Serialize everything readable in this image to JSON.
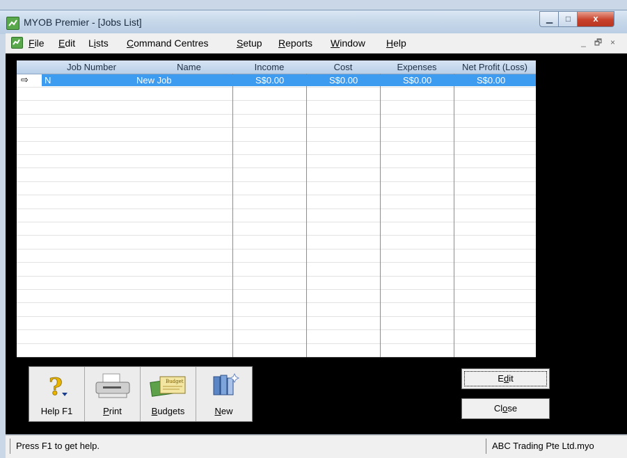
{
  "window": {
    "title": "MYOB Premier - [Jobs List]",
    "controls": {
      "minimize": "▁",
      "maximize": "□",
      "close": "x"
    }
  },
  "menubar": {
    "items": [
      {
        "label": "File",
        "underline": "F"
      },
      {
        "label": "Edit",
        "underline": "E"
      },
      {
        "label": "Lists",
        "underline": "i"
      },
      {
        "label": "Command Centres",
        "underline": "C"
      },
      {
        "label": "Setup",
        "underline": "S"
      },
      {
        "label": "Reports",
        "underline": "R"
      },
      {
        "label": "Window",
        "underline": "W"
      },
      {
        "label": "Help",
        "underline": "H"
      }
    ],
    "mdi_controls": {
      "minimize": "_",
      "restore": "🗗",
      "close": "×"
    }
  },
  "grid": {
    "columns": [
      "Job Number",
      "Name",
      "Income",
      "Cost",
      "Expenses",
      "Net Profit (Loss)"
    ],
    "selected_row": {
      "job_number": "N",
      "name": "New Job",
      "income": "S$0.00",
      "cost": "S$0.00",
      "expenses": "S$0.00",
      "net_profit": "S$0.00"
    },
    "row_marker": "⇨"
  },
  "toolbar": {
    "buttons": [
      {
        "label": "Help F1",
        "icon": "help-icon"
      },
      {
        "label": "Print",
        "underline": "P",
        "icon": "printer-icon"
      },
      {
        "label": "Budgets",
        "underline": "B",
        "icon": "budget-icon"
      },
      {
        "label": "New",
        "underline": "N",
        "icon": "new-document-icon"
      }
    ]
  },
  "actions": {
    "edit": "Edit",
    "close": "Close"
  },
  "statusbar": {
    "help_text": "Press F1 to get help.",
    "file_name": "ABC Trading Pte Ltd.myo"
  },
  "colors": {
    "selection": "#3d9bf0",
    "workspace": "#000000",
    "header_gradient": "#c7d8ea"
  }
}
